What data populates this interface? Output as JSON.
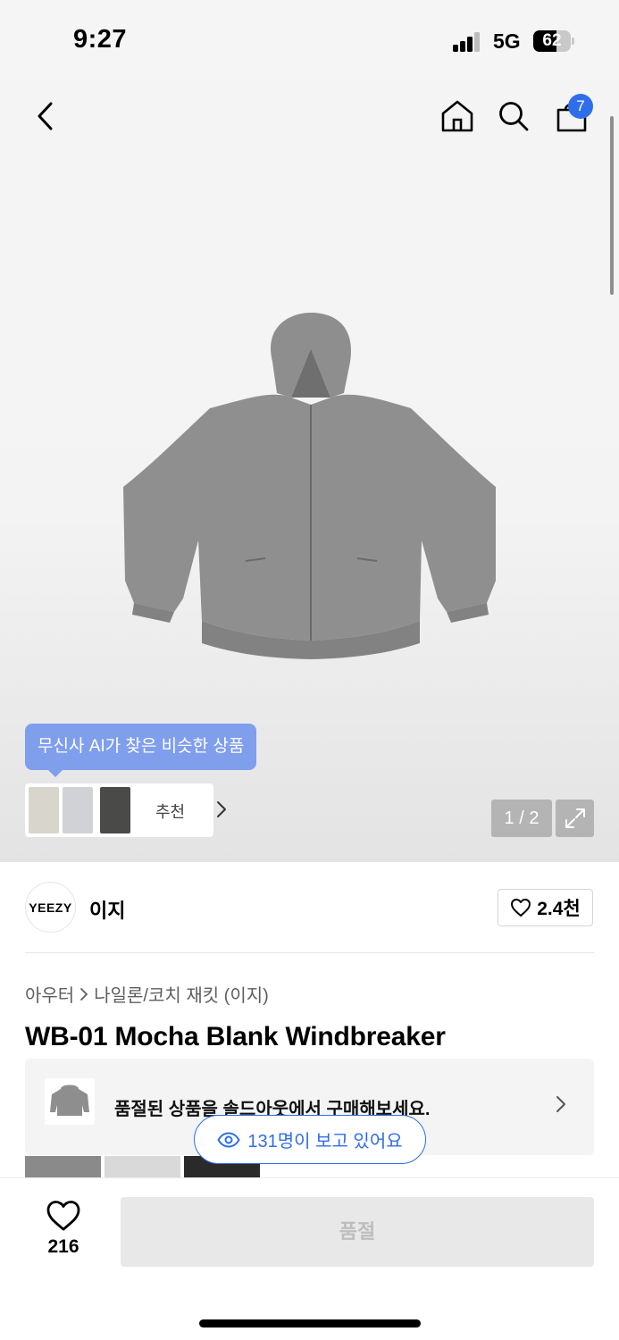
{
  "status": {
    "time": "9:27",
    "network": "5G",
    "battery": "62",
    "battery_level": 0.62
  },
  "topnav": {
    "cart_count": "7"
  },
  "gallery": {
    "pager": "1 / 2"
  },
  "ai_recommend": {
    "tooltip": "무신사 AI가 찾은 비슷한 상품",
    "label": "추천"
  },
  "brand": {
    "logo_text": "YEEZY",
    "name": "이지",
    "likes": "2.4천"
  },
  "breadcrumb": {
    "level1": "아우터",
    "level2": "나일론/코치 재킷 (이지)"
  },
  "product": {
    "title": "WB-01 Mocha Blank Windbreaker"
  },
  "soldout_notice": {
    "text": "품절된 상품을 솔드아웃에서 구매해보세요."
  },
  "viewers": {
    "text": "131명이 보고 있어요"
  },
  "bottom": {
    "like_count": "216",
    "buy_label": "품절"
  },
  "colors": {
    "accent": "#2f6eea",
    "tooltip": "#7f9eec"
  }
}
